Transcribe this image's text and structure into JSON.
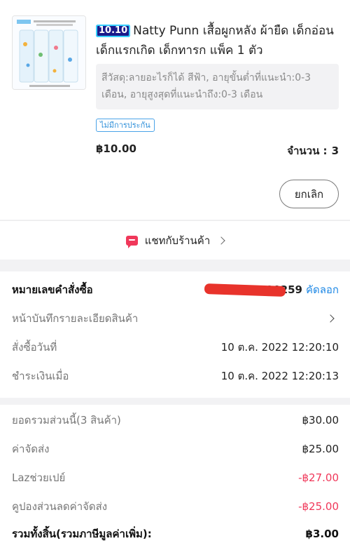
{
  "product": {
    "badge": "10.10",
    "title": "Natty Punn เสื้อผูกหลัง ผ้ายืด เด็กอ่อน เด็กแรกเกิด เด็กทารก แพ็ค 1 ตัว",
    "variant": "สีวัสดุ:ลายอะไรก็ได้ สีฟ้า, อายุขั้นต่ำที่แนะนำ:0-3 เดือน, อายุสูงสุดที่แนะนำถึง:0-3 เดือน",
    "warranty": "ไม่มีการประกัน",
    "price": "฿10.00",
    "quantity_label": "จำนวน :",
    "quantity": "3",
    "cancel_label": "ยกเลิก"
  },
  "chat": {
    "label": "แชทกับร้านค้า",
    "icon": "chat-bubble-icon"
  },
  "order": {
    "number_label": "หมายเลขคำสั่งซื้อ",
    "number_value": "5000000000259",
    "copy_label": "คัดลอก",
    "note_label": "หน้าบันทึกรายละเอียดสินค้า",
    "ordered_label": "สั่งซื้อวันที่",
    "ordered_value": "10 ต.ค. 2022  12:20:10",
    "paid_label": "ชำระเงินเมื่อ",
    "paid_value": "10 ต.ค. 2022  12:20:13"
  },
  "totals": {
    "subtotal_label": "ยอดรวมส่วนนี้(3 สินค้า)",
    "subtotal_value": "฿30.00",
    "shipping_label": "ค่าจัดส่ง",
    "shipping_value": "฿25.00",
    "lazpay_label": "Lazช่วยเปย์",
    "lazpay_value": "-฿27.00",
    "coupon_label": "คูปองส่วนลดค่าจัดส่ง",
    "coupon_value": "-฿25.00",
    "grand_label": "รวมทั้งสิ้น(รวมภาษีมูลค่าเพิ่ม):",
    "grand_value": "฿3.00"
  },
  "colors": {
    "accent": "#1e88e5",
    "discount": "#f0385a",
    "background": "#f2f2f4"
  }
}
